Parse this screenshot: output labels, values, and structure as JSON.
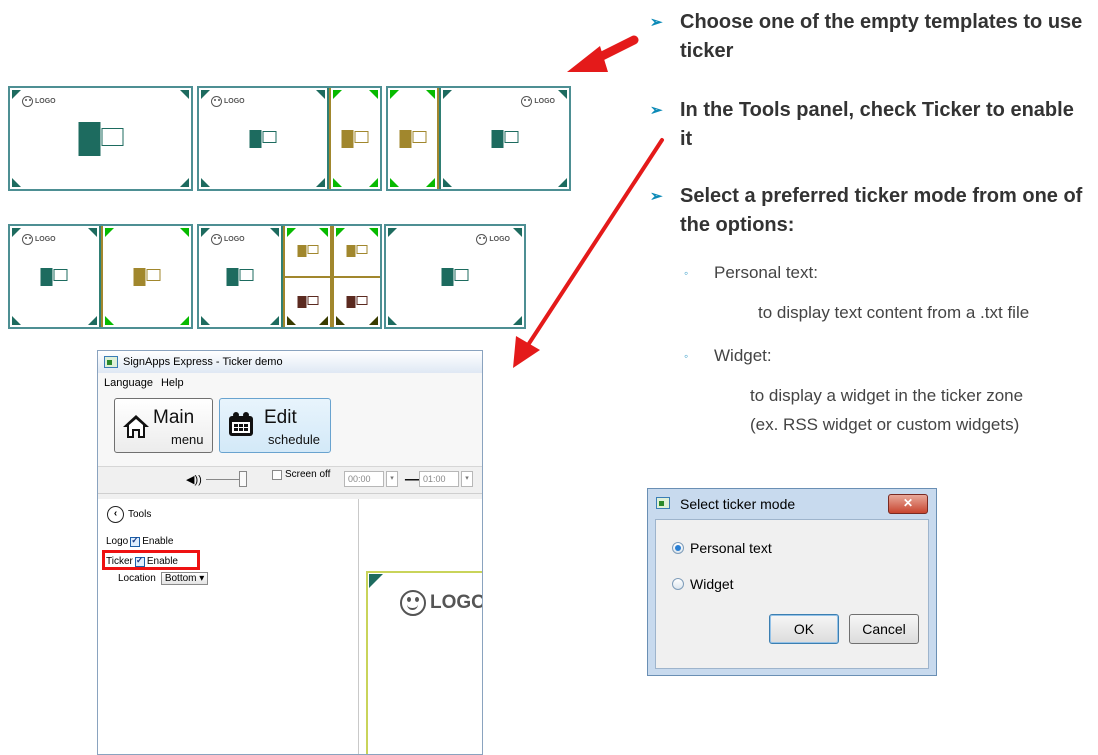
{
  "templates": {
    "logo_text": "LOGO"
  },
  "app": {
    "title": "SignApps Express - Ticker demo",
    "menu": [
      "Language",
      "Help"
    ],
    "main_button": {
      "title": "Main",
      "subtitle": "menu"
    },
    "edit_button": {
      "title": "Edit",
      "subtitle": "schedule"
    },
    "screen_off_label": "Screen off",
    "time_from": "00:00",
    "time_to": "01:00",
    "tools_label": "Tools",
    "logo_label": "Logo",
    "logo_enable": "Enable",
    "ticker_label": "Ticker",
    "ticker_enable": "Enable",
    "location_label": "Location",
    "location_value": "Bottom",
    "preview_logo": "LOGO"
  },
  "instructions": {
    "step1": "Choose one of the empty templates to use ticker",
    "step2": "In the Tools panel, check Ticker to enable it",
    "step3": "Select a preferred ticker mode from one of the options:",
    "option1_title": "Personal text:",
    "option1_desc": "to display text content from a .txt file",
    "option2_title": "Widget:",
    "option2_desc_line1": "to display a widget in the ticker zone",
    "option2_desc_line2": "(ex. RSS widget or custom widgets)"
  },
  "dialog": {
    "title": "Select ticker mode",
    "close": "✕",
    "option_personal": "Personal text",
    "option_widget": "Widget",
    "selected": "Personal text",
    "ok": "OK",
    "cancel": "Cancel"
  },
  "colors": {
    "arrow": "#e41a1a",
    "bullet": "#0c8ab7",
    "highlight": "#ee1111",
    "teal": "#1d6b5f",
    "olive": "#a1872d",
    "brown": "#5b2a20"
  }
}
